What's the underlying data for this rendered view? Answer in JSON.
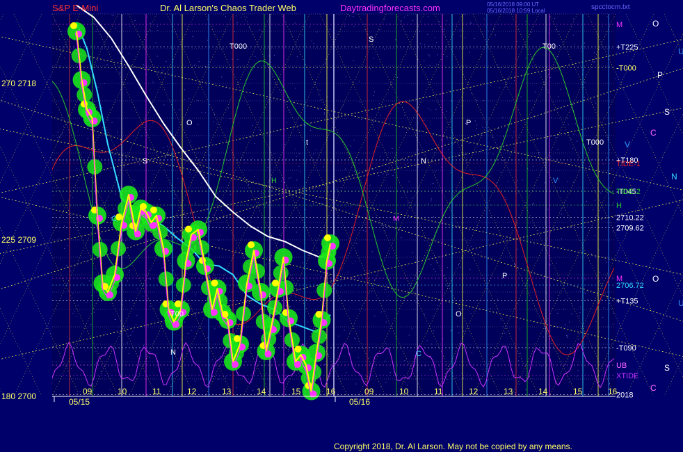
{
  "header": {
    "symbol": "S&P E-Mini",
    "site_title": "Dr. Al Larson's Chaos Trader Web",
    "website": "Daytradingforecasts.com",
    "meta_line_1": "05/16/2018 09:00 UT",
    "meta_line_2": "05/16/2018 10:59 Local",
    "file_name": "spcctocm.txt"
  },
  "footer": {
    "copyright": "Copyright 2018, Dr. Al Larson. May not be copied by any means."
  },
  "colors": {
    "background": "#00006b",
    "plot_bg": "#00005a",
    "price_line": "#ffff00",
    "price_markers": "#ff33ff",
    "price_glow": "#19e619",
    "yellow_dots": "#ffff00",
    "cyan_avg": "#33ddff",
    "white_avg": "#ffffff",
    "tide1": "#e82020",
    "tide2": "#29c929",
    "xtide": "#cc33ff"
  },
  "chart_data": {
    "type": "line",
    "title": "S&P E-Mini",
    "ylim": [
      2700,
      2722
    ],
    "y_ticks": [
      {
        "value": 2718,
        "label": "270  2718"
      },
      {
        "value": 2709,
        "label": "225  2709"
      },
      {
        "value": 2700,
        "label": "180  2700"
      }
    ],
    "x_hours_day1": [
      "09",
      "10",
      "11",
      "12",
      "13",
      "14",
      "15",
      "16"
    ],
    "x_hours_day2": [
      "09",
      "10",
      "11",
      "12",
      "13",
      "14",
      "15",
      "16"
    ],
    "dates": [
      "05/15",
      "05/16"
    ],
    "series": [
      {
        "name": "S&P E-Mini",
        "x": [
          8.7,
          8.85,
          9.0,
          9.15,
          9.3,
          9.45,
          9.6,
          9.8,
          10.0,
          10.2,
          10.4,
          10.55,
          10.7,
          10.85,
          11.0,
          11.2,
          11.35,
          11.5,
          11.7,
          11.85,
          12.0,
          12.2,
          12.4,
          12.6,
          12.75,
          12.9,
          13.05,
          13.2,
          13.4,
          13.6,
          13.8,
          14.0,
          14.15,
          14.3,
          14.5,
          14.65,
          14.8,
          15.0,
          15.15,
          15.3,
          15.45,
          15.6,
          15.75,
          15.9,
          16.0
        ],
        "y": [
          2721.0,
          2718.2,
          2716.5,
          2716.0,
          2710.4,
          2706.5,
          2706.0,
          2707.0,
          2710.0,
          2711.6,
          2709.5,
          2710.8,
          2710.6,
          2710.0,
          2710.4,
          2708.5,
          2705.0,
          2704.3,
          2705.0,
          2707.8,
          2709.3,
          2709.6,
          2707.5,
          2705.0,
          2706.2,
          2704.8,
          2704.4,
          2702.0,
          2703.0,
          2706.5,
          2708.4,
          2706.0,
          2702.6,
          2704.0,
          2706.2,
          2708.0,
          2704.5,
          2702.0,
          2702.4,
          2701.8,
          2700.3,
          2702.5,
          2704.4,
          2707.8,
          2708.8
        ]
      },
      {
        "name": "cyan average",
        "x": [
          8.7,
          9.0,
          9.3,
          9.6,
          10.0,
          10.4,
          10.8,
          11.2,
          11.6,
          12.0,
          12.4,
          12.8,
          13.2,
          13.6,
          14.0,
          14.4,
          14.8,
          15.2,
          15.6,
          16.0
        ],
        "y": [
          2721.5,
          2720.0,
          2717.5,
          2714.5,
          2711.4,
          2710.6,
          2710.3,
          2709.8,
          2709.1,
          2708.5,
          2707.6,
          2707.5,
          2707.0,
          2705.8,
          2705.3,
          2705.0,
          2704.3,
          2704.0,
          2703.7,
          2704.7
        ]
      },
      {
        "name": "white average",
        "x": [
          8.7,
          9.2,
          9.7,
          10.2,
          10.7,
          11.2,
          11.7,
          12.2,
          12.7,
          13.2,
          13.7,
          14.2,
          14.7,
          15.2,
          15.7,
          16.0
        ],
        "y": [
          2722.5,
          2721.8,
          2720.6,
          2719.0,
          2717.3,
          2715.7,
          2714.3,
          2713.0,
          2711.5,
          2710.6,
          2709.8,
          2709.2,
          2708.9,
          2708.4,
          2708.0,
          2708.2
        ]
      }
    ],
    "right_labels": [
      {
        "label": "M",
        "value": 2721.4,
        "color": "#ff33ff"
      },
      {
        "label": "+T225",
        "value": 2720.1,
        "color": "#ffffff"
      },
      {
        "label": "-T000",
        "value": 2718.9,
        "color": "#ffff66"
      },
      {
        "label": "+T180",
        "value": 2713.6,
        "color": "#ffffff"
      },
      {
        "label": "TIDE-1",
        "value": 2713.4,
        "color": "#e82020"
      },
      {
        "label": "-T045",
        "value": 2711.8,
        "color": "#ffffff"
      },
      {
        "label": "TIDE-2",
        "value": 2711.8,
        "color": "#29c929"
      },
      {
        "label": "H",
        "value": 2711.0,
        "color": "#29c929"
      },
      {
        "label": "2710.22",
        "value": 2710.3,
        "color": "#ffffff"
      },
      {
        "label": "2709.62",
        "value": 2709.7,
        "color": "#ffffff"
      },
      {
        "label": "M",
        "value": 2706.8,
        "color": "#ff33ff"
      },
      {
        "label": "2706.72",
        "value": 2706.4,
        "color": "#33ddff"
      },
      {
        "label": "+T135",
        "value": 2705.5,
        "color": "#ffffff"
      },
      {
        "label": "-T090",
        "value": 2702.8,
        "color": "#ffffff"
      },
      {
        "label": "UB",
        "value": 2701.8,
        "color": "#ff66ff"
      },
      {
        "label": "XTIDE",
        "value": 2701.2,
        "color": "#cc33ff"
      },
      {
        "label": "2018",
        "value": 2700.1,
        "color": "#ffffff"
      }
    ],
    "letters_far_right": [
      {
        "label": "O",
        "color": "#ffffff"
      },
      {
        "label": "U",
        "color": "#3399ff"
      },
      {
        "label": "P",
        "color": "#ffffff"
      },
      {
        "label": "S",
        "color": "#ffffff"
      },
      {
        "label": "C",
        "color": "#ff66ff"
      },
      {
        "label": "V",
        "color": "#3399ff"
      },
      {
        "label": "N",
        "color": "#33ddff"
      },
      {
        "label": "O",
        "color": "#ffffff"
      },
      {
        "label": "U",
        "color": "#3399ff"
      },
      {
        "label": "S",
        "color": "#ffffff"
      },
      {
        "label": "C",
        "color": "#ff66ff"
      }
    ],
    "plot_markers": [
      "T000",
      "T00",
      "O",
      "P",
      "S",
      "N",
      "C",
      "M",
      "H",
      "V",
      "t"
    ]
  }
}
